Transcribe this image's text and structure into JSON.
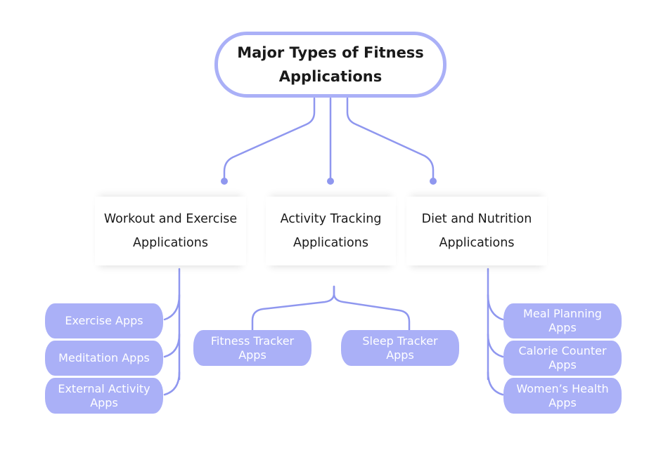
{
  "diagram": {
    "title": "Major Types of Fitness Applications",
    "colors": {
      "accent": "#aab0f7",
      "connector": "#8f97ef",
      "text_dark": "#1a1a1a",
      "leaf_text": "#ffffff",
      "background": "#ffffff"
    },
    "categories": [
      {
        "label": "Workout and Exercise Applications",
        "children": [
          "Exercise Apps",
          "Meditation Apps",
          "External Activity Apps"
        ]
      },
      {
        "label": "Activity Tracking Applications",
        "children": [
          "Fitness Tracker Apps",
          "Sleep Tracker Apps"
        ]
      },
      {
        "label": "Diet and Nutrition Applications",
        "children": [
          "Meal Planning Apps",
          "Calorie Counter Apps",
          "Women’s Health Apps"
        ]
      }
    ]
  }
}
